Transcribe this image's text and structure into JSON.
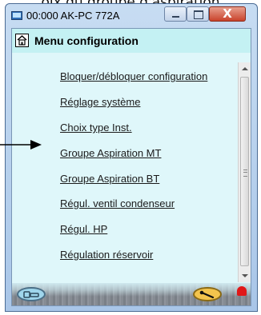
{
  "caption": "oix du groupe d'aspiration",
  "window": {
    "title": "00:000 AK-PC 772A",
    "controls": {
      "close_label": "X"
    }
  },
  "menu": {
    "title": "Menu configuration",
    "items": [
      {
        "label": "Bloquer/débloquer configuration"
      },
      {
        "label": "Réglage système"
      },
      {
        "label": "Choix type Inst."
      },
      {
        "label": "Groupe Aspiration MT"
      },
      {
        "label": "Groupe Aspiration BT"
      },
      {
        "label": "Régul. ventil condenseur"
      },
      {
        "label": "Régul. HP"
      },
      {
        "label": "Régulation réservoir"
      }
    ]
  },
  "icons": {
    "home": "home-icon",
    "app": "app-icon",
    "scroll_up": "scroll-up-arrow-icon",
    "scroll_down": "scroll-down-arrow-icon",
    "left_oval": "device-icon",
    "right_oval": "wrench-icon",
    "bell": "alarm-bell-icon",
    "pointer": "pointer-arrow-icon"
  },
  "colors": {
    "client_bg": "#dff7fa",
    "header_bg": "#c4f1f3",
    "alarm": "#e01818",
    "tool_oval": "#f3c44d"
  }
}
